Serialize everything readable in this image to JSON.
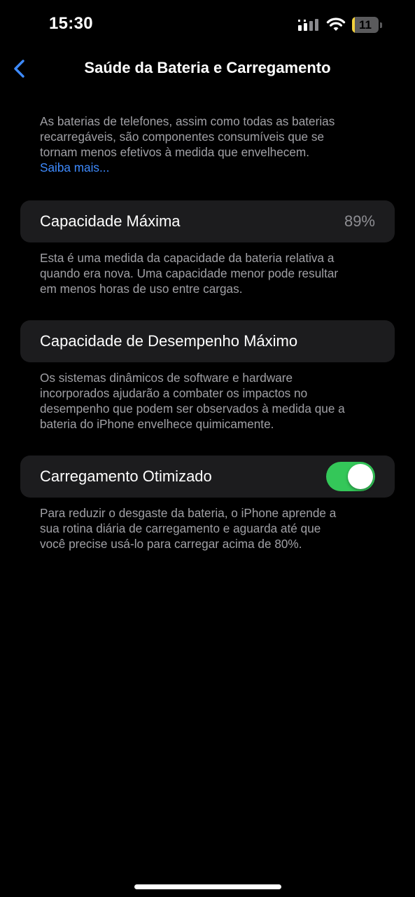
{
  "status_bar": {
    "time": "15:30",
    "battery_level": "11",
    "battery_fraction": 0.11,
    "battery_color": "#f2d13c",
    "icons": [
      "signal-icon",
      "wifi-icon",
      "battery-icon"
    ]
  },
  "nav": {
    "title": "Saúde da Bateria e Carregamento",
    "back_icon": "chevron-left-icon",
    "accent_color": "#3e8bff"
  },
  "intro": {
    "lines": [
      "As baterias de telefones, assim como todas as baterias",
      "recarregáveis, são componentes consumíveis que se",
      "tornam menos efetivos à medida que envelhecem."
    ],
    "learn_more": "Saiba mais..."
  },
  "max_capacity": {
    "label": "Capacidade Máxima",
    "value": "89%",
    "footer_lines": [
      "Esta é uma medida da capacidade da bateria relativa a",
      "quando era nova. Uma capacidade menor pode resultar",
      "em menos horas de uso entre cargas."
    ]
  },
  "peak_performance": {
    "label": "Capacidade de Desempenho Máximo",
    "footer_lines": [
      "Os sistemas dinâmicos de software e hardware",
      "incorporados ajudarão a combater os impactos no",
      "desempenho que podem ser observados à medida que a",
      "bateria do iPhone envelhece quimicamente."
    ]
  },
  "optimized_charging": {
    "label": "Carregamento Otimizado",
    "enabled": true,
    "toggle_color": "#34c759",
    "footer_lines": [
      "Para reduzir o desgaste da bateria, o iPhone aprende a",
      "sua rotina diária de carregamento e aguarda até que",
      "você precise usá-lo para carregar acima de 80%."
    ]
  }
}
